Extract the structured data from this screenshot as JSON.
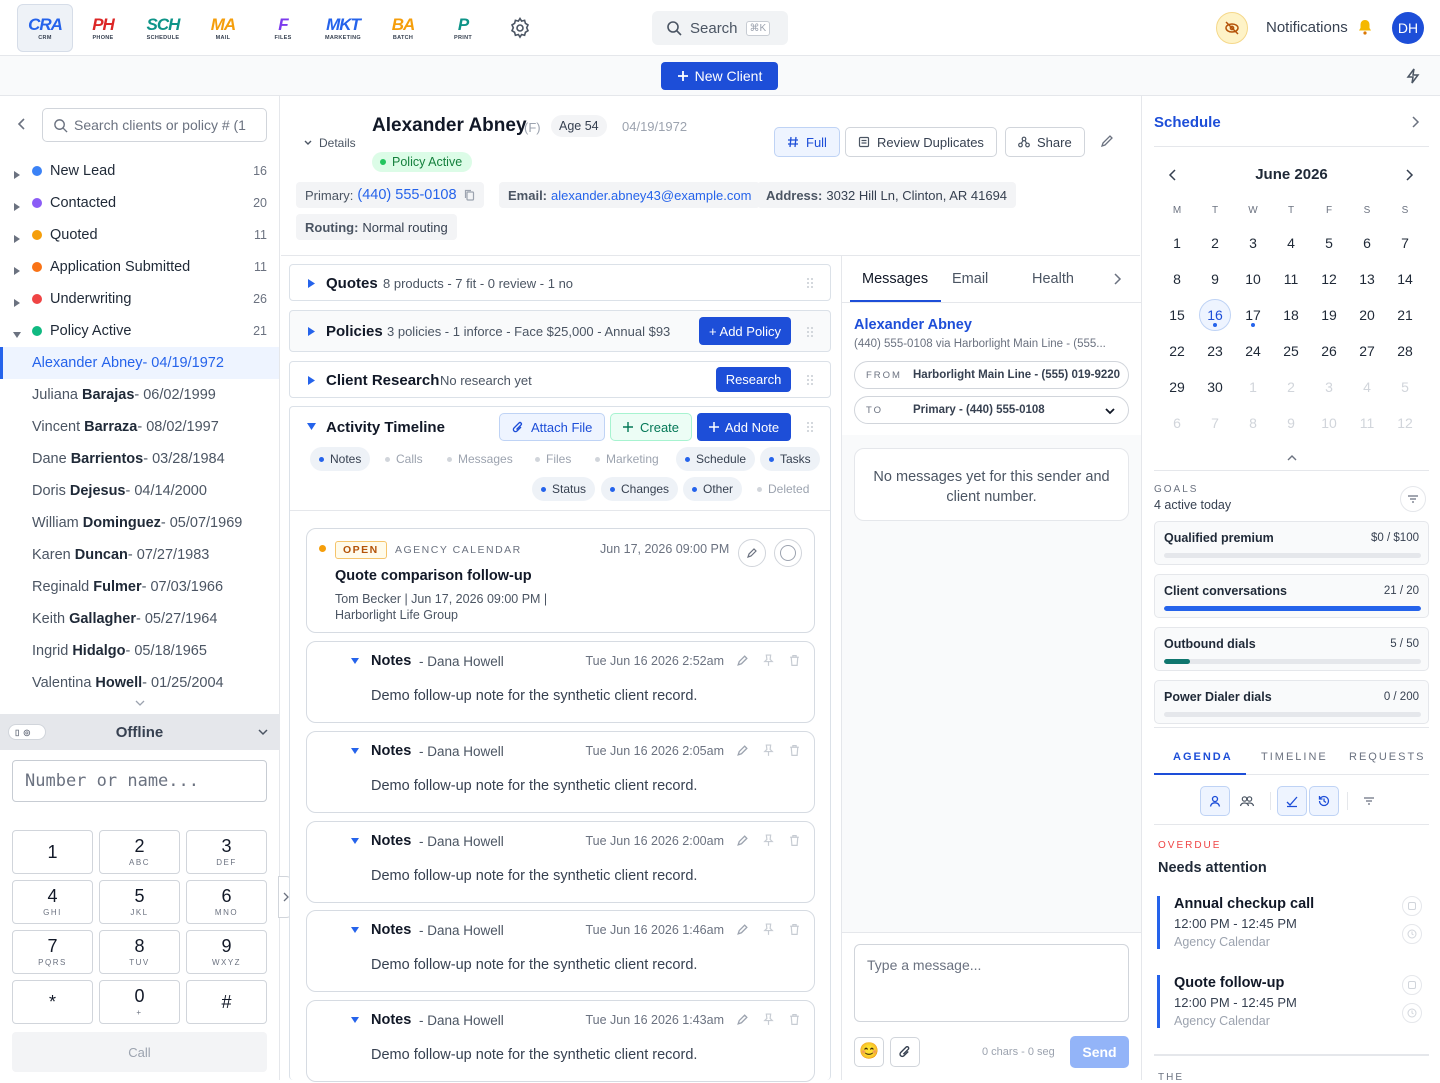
{
  "apps": [
    {
      "lg": "CRA",
      "sm": "CRM",
      "color": "#2563eb"
    },
    {
      "lg": "PH",
      "sm": "PHONE",
      "color": "#dc2626"
    },
    {
      "lg": "SCH",
      "sm": "SCHEDULE",
      "color": "#0d9488"
    },
    {
      "lg": "MA",
      "sm": "MAIL",
      "color": "#f59e0b"
    },
    {
      "lg": "F",
      "sm": "FILES",
      "color": "#7c3aed"
    },
    {
      "lg": "MKT",
      "sm": "MARKETING",
      "color": "#2563eb"
    },
    {
      "lg": "BA",
      "sm": "BATCH",
      "color": "#f59e0b"
    },
    {
      "lg": "P",
      "sm": "PRINT",
      "color": "#0d9488"
    }
  ],
  "topbar": {
    "search_label": "Search",
    "search_kbd": "⌘K",
    "notifications": "Notifications",
    "avatar": "DH"
  },
  "new_client": "New Client",
  "left": {
    "search_placeholder": "Search clients or policy # (1",
    "groups": [
      {
        "name": "New Lead",
        "count": "16",
        "color": "#3b82f6"
      },
      {
        "name": "Contacted",
        "count": "20",
        "color": "#8b5cf6"
      },
      {
        "name": "Quoted",
        "count": "11",
        "color": "#f59e0b"
      },
      {
        "name": "Application Submitted",
        "count": "11",
        "color": "#f97316"
      },
      {
        "name": "Underwriting",
        "count": "26",
        "color": "#ef4444"
      },
      {
        "name": "Policy Active",
        "count": "21",
        "color": "#10b981"
      }
    ],
    "clients": [
      {
        "first": "Alexander",
        "last": "Abney",
        "dob": " - 04/19/1972"
      },
      {
        "first": "Juliana",
        "last": "Barajas",
        "dob": " - 06/02/1999"
      },
      {
        "first": "Vincent",
        "last": "Barraza",
        "dob": " - 08/02/1997"
      },
      {
        "first": "Dane",
        "last": "Barrientos",
        "dob": " - 03/28/1984"
      },
      {
        "first": "Doris",
        "last": "Dejesus",
        "dob": " - 04/14/2000"
      },
      {
        "first": "William",
        "last": "Dominguez",
        "dob": " - 05/07/1969"
      },
      {
        "first": "Karen",
        "last": "Duncan",
        "dob": " - 07/27/1983"
      },
      {
        "first": "Reginald",
        "last": "Fulmer",
        "dob": " - 07/03/1966"
      },
      {
        "first": "Keith",
        "last": "Gallagher",
        "dob": " - 05/27/1964"
      },
      {
        "first": "Ingrid",
        "last": "Hidalgo",
        "dob": " - 05/18/1965"
      },
      {
        "first": "Valentina",
        "last": "Howell",
        "dob": " - 01/25/2004"
      }
    ],
    "dialer_status": "Offline",
    "number_placeholder": "Number or name...",
    "keys": [
      {
        "d": "1",
        "l": ""
      },
      {
        "d": "2",
        "l": "ABC"
      },
      {
        "d": "3",
        "l": "DEF"
      },
      {
        "d": "4",
        "l": "GHI"
      },
      {
        "d": "5",
        "l": "JKL"
      },
      {
        "d": "6",
        "l": "MNO"
      },
      {
        "d": "7",
        "l": "PQRS"
      },
      {
        "d": "8",
        "l": "TUV"
      },
      {
        "d": "9",
        "l": "WXYZ"
      },
      {
        "d": "*",
        "l": ""
      },
      {
        "d": "0",
        "l": "+"
      },
      {
        "d": "#",
        "l": ""
      }
    ],
    "call": "Call"
  },
  "client": {
    "details": "Details",
    "name": "Alexander Abney",
    "sex": "(F)",
    "age": "Age 54",
    "dob": "04/19/1972",
    "status": "Policy Active",
    "btn_full": "Full",
    "btn_dup": "Review Duplicates",
    "btn_share": "Share",
    "primary_label": "Primary:",
    "primary": "(440) 555-0108",
    "email_label": "Email:",
    "email": "alexander.abney43@example.com",
    "address_label": "Address:",
    "address": "3032 Hill Ln, Clinton, AR 41694",
    "routing_label": "Routing:",
    "routing": "Normal routing"
  },
  "cards": {
    "quotes": {
      "title": "Quotes",
      "sub": "8 products - 7 fit - 0 review - 1 no"
    },
    "policies": {
      "title": "Policies",
      "sub": "3 policies - 1 inforce - Face $25,000 - Annual $93",
      "btn": "+ Add Policy"
    },
    "research": {
      "title": "Client Research",
      "sub": "No research yet",
      "btn": "Research"
    },
    "timeline": {
      "title": "Activity Timeline",
      "attach": "Attach File",
      "create": "Create",
      "add_note": "Add Note"
    }
  },
  "filters": [
    {
      "label": "Notes",
      "on": true
    },
    {
      "label": "Calls",
      "on": false
    },
    {
      "label": "Messages",
      "on": false
    },
    {
      "label": "Files",
      "on": false
    },
    {
      "label": "Marketing",
      "on": false
    },
    {
      "label": "Schedule",
      "on": true
    },
    {
      "label": "Tasks",
      "on": true
    },
    {
      "label": "Status",
      "on": true
    },
    {
      "label": "Changes",
      "on": true
    },
    {
      "label": "Other",
      "on": true
    },
    {
      "label": "Deleted",
      "on": false
    }
  ],
  "event": {
    "badge": "OPEN",
    "source": "AGENCY CALENDAR",
    "date": "Jun 17, 2026 09:00 PM",
    "title": "Quote comparison follow-up",
    "meta1": "Tom Becker | Jun 17, 2026 09:00 PM |",
    "meta2": "Harborlight Life Group"
  },
  "notes": [
    {
      "title": "Notes",
      "author": "- Dana Howell",
      "date": "Tue Jun 16 2026 2:52am",
      "body": "Demo follow-up note for the synthetic client record."
    },
    {
      "title": "Notes",
      "author": "- Dana Howell",
      "date": "Tue Jun 16 2026 2:05am",
      "body": "Demo follow-up note for the synthetic client record."
    },
    {
      "title": "Notes",
      "author": "- Dana Howell",
      "date": "Tue Jun 16 2026 2:00am",
      "body": "Demo follow-up note for the synthetic client record."
    },
    {
      "title": "Notes",
      "author": "- Dana Howell",
      "date": "Tue Jun 16 2026 1:46am",
      "body": "Demo follow-up note for the synthetic client record."
    },
    {
      "title": "Notes",
      "author": "- Dana Howell",
      "date": "Tue Jun 16 2026 1:43am",
      "body": "Demo follow-up note for the synthetic client record."
    }
  ],
  "messages": {
    "tabs": [
      "Messages",
      "Email",
      "Health"
    ],
    "contact": "Alexander Abney",
    "contact_sub": "(440) 555-0108 via Harborlight Main Line - (555...",
    "from_label": "FROM",
    "from": "Harborlight Main Line - (555) 019-9220",
    "to_label": "TO",
    "to": "Primary - (440) 555-0108",
    "empty": "No messages yet for this sender and client number.",
    "placeholder": "Type a message...",
    "counter": "0 chars - 0 seg",
    "send": "Send"
  },
  "schedule": {
    "title": "Schedule",
    "month": "June 2026",
    "dow": [
      "M",
      "T",
      "W",
      "T",
      "F",
      "S",
      "S"
    ],
    "weeks": [
      [
        {
          "d": "1"
        },
        {
          "d": "2"
        },
        {
          "d": "3"
        },
        {
          "d": "4"
        },
        {
          "d": "5"
        },
        {
          "d": "6"
        },
        {
          "d": "7"
        }
      ],
      [
        {
          "d": "8"
        },
        {
          "d": "9"
        },
        {
          "d": "10"
        },
        {
          "d": "11"
        },
        {
          "d": "12"
        },
        {
          "d": "13"
        },
        {
          "d": "14"
        }
      ],
      [
        {
          "d": "15"
        },
        {
          "d": "16",
          "today": true,
          "dot": true
        },
        {
          "d": "17",
          "dot": true
        },
        {
          "d": "18"
        },
        {
          "d": "19"
        },
        {
          "d": "20"
        },
        {
          "d": "21"
        }
      ],
      [
        {
          "d": "22"
        },
        {
          "d": "23"
        },
        {
          "d": "24"
        },
        {
          "d": "25"
        },
        {
          "d": "26"
        },
        {
          "d": "27"
        },
        {
          "d": "28"
        }
      ],
      [
        {
          "d": "29"
        },
        {
          "d": "30"
        },
        {
          "d": "1",
          "muted": true
        },
        {
          "d": "2",
          "muted": true
        },
        {
          "d": "3",
          "muted": true
        },
        {
          "d": "4",
          "muted": true
        },
        {
          "d": "5",
          "muted": true
        }
      ],
      [
        {
          "d": "6",
          "muted": true
        },
        {
          "d": "7",
          "muted": true
        },
        {
          "d": "8",
          "muted": true
        },
        {
          "d": "9",
          "muted": true
        },
        {
          "d": "10",
          "muted": true
        },
        {
          "d": "11",
          "muted": true
        },
        {
          "d": "12",
          "muted": true
        }
      ]
    ],
    "goals_label": "GOALS",
    "goals_sub": "4 active today",
    "goals": [
      {
        "name": "Qualified premium",
        "value": "$0 / $100",
        "fraction": 0,
        "color": "#2563eb"
      },
      {
        "name": "Client conversations",
        "value": "21 / 20",
        "fraction": 1,
        "color": "#2563eb"
      },
      {
        "name": "Outbound dials",
        "value": "5 / 50",
        "fraction": 0.1,
        "color": "#0f766e"
      },
      {
        "name": "Power Dialer dials",
        "value": "0 / 200",
        "fraction": 0,
        "color": "#2563eb"
      }
    ],
    "agenda_tabs": [
      "AGENDA",
      "TIMELINE",
      "REQUESTS"
    ],
    "overdue": "OVERDUE",
    "needs": "Needs attention",
    "items": [
      {
        "title": "Annual checkup call",
        "time": "12:00 PM - 12:45 PM",
        "cal": "Agency Calendar"
      },
      {
        "title": "Quote follow-up",
        "time": "12:00 PM - 12:45 PM",
        "cal": "Agency Calendar"
      }
    ],
    "cut_label": "THE"
  }
}
